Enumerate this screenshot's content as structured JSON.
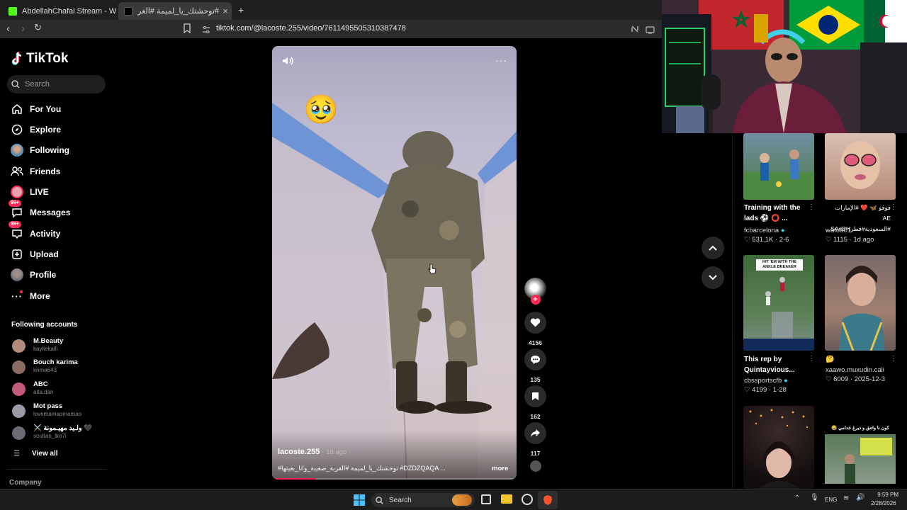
{
  "browser": {
    "tabs": [
      {
        "title": "AbdellahChafai Stream - Watch Live :",
        "active": false
      },
      {
        "title": "#توحشتك_يا_لميمة #الغربة_صعيبة",
        "active": true
      }
    ],
    "new_tab": "+",
    "url": "tiktok.com/@lacoste.255/video/7611495505310387478"
  },
  "sidebar": {
    "logo": "TikTok",
    "search_placeholder": "Search",
    "nav": [
      {
        "label": "For You",
        "icon": "home-icon"
      },
      {
        "label": "Explore",
        "icon": "compass-icon"
      },
      {
        "label": "Following",
        "icon": "avatar-icon"
      },
      {
        "label": "Friends",
        "icon": "friends-icon"
      },
      {
        "label": "LIVE",
        "icon": "live-icon"
      },
      {
        "label": "Messages",
        "icon": "messages-icon",
        "badge": "99+"
      },
      {
        "label": "Activity",
        "icon": "activity-icon",
        "badge": "99+"
      },
      {
        "label": "Upload",
        "icon": "upload-icon"
      },
      {
        "label": "Profile",
        "icon": "profile-icon"
      },
      {
        "label": "More",
        "icon": "more-icon"
      }
    ],
    "following_title": "Following accounts",
    "accounts": [
      {
        "name": "M.Beauty",
        "handle": "kayliekalli",
        "color": "#b48a7a"
      },
      {
        "name": "Bouch karima",
        "handle": "krima643",
        "color": "#8a6c64"
      },
      {
        "name": "ABC",
        "handle": "aita.dan",
        "color": "#c45a7a"
      },
      {
        "name": "Mot pass",
        "handle": "lovemamaomamao",
        "color": "#9a9aa8"
      },
      {
        "name": "⚔️ ولـيد مهيـمونة 🖤",
        "handle": "soultan_lko7i",
        "color": "#6b6b78"
      }
    ],
    "view_all": "View all",
    "company": "Company"
  },
  "video": {
    "author": "lacoste.255",
    "age": "1d ago",
    "caption": "#توحشتك_يا_لميمة #الغربة_صعيبة_وانا_بغيتها #DZDZQAQA ...",
    "more": "more",
    "emoji": "🥹",
    "progress": 0.18
  },
  "actions": [
    {
      "name": "like",
      "count": "4156"
    },
    {
      "name": "comment",
      "count": "135"
    },
    {
      "name": "bookmark",
      "count": "162"
    },
    {
      "name": "share",
      "count": "117"
    }
  ],
  "feed": [
    {
      "title": "Training with the lads ⚽ ⭕ ...",
      "user": "fcbarcelona",
      "verified": true,
      "likes": "531.1K",
      "date": "2-6",
      "bg": "#3d6a8a"
    },
    {
      "title": "فوفو 🦋 ❤️ #الإمارات AE #السعودية#قطرSA#BH...",
      "user": "wafoa01",
      "verified": false,
      "likes": "1115",
      "date": "1d ago",
      "bg": "#b89a88"
    },
    {
      "title": "This rep by Quintayvious...",
      "user": "cbssportscfb",
      "verified": true,
      "likes": "4199",
      "date": "1-28",
      "bg": "#5a7a4a"
    },
    {
      "title": "🤔",
      "user": "xaawo.muxudin.cali",
      "verified": false,
      "likes": "6009",
      "date": "2025-12-3",
      "bg": "#8a6a5a"
    }
  ],
  "feed_overlays": {
    "rep_banner": "HIT 'EM WITH THE ANKLE BREAKER",
    "arabic_top": "كون نا واتنق و ديرغ خدامي 😂"
  },
  "taskbar": {
    "search": "Search",
    "lang": "ENG",
    "time": "9:59 PM",
    "date": "2/28/2026"
  }
}
